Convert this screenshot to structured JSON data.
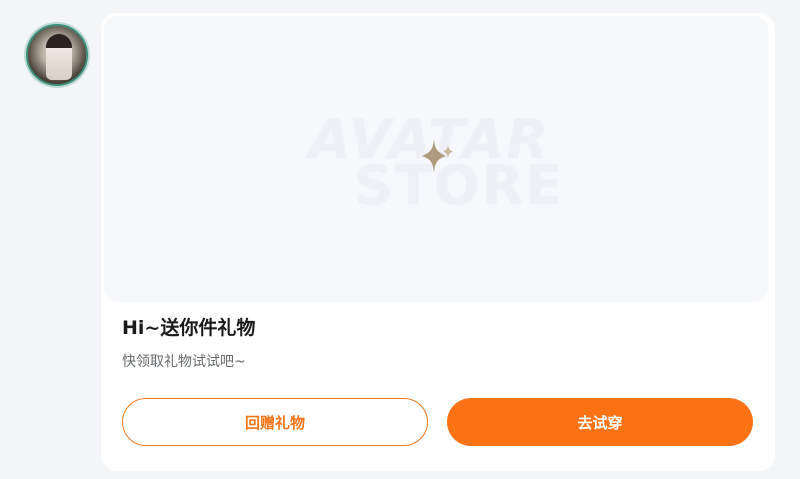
{
  "user": {
    "avatar_icon": "user-avatar"
  },
  "banner": {
    "watermark_line1": "AVATAR",
    "watermark_line2": "STORE",
    "center_icon": "sparkle-icon",
    "icon_color": "#b09a7e"
  },
  "gift": {
    "title": "Hi~送你件礼物",
    "subtitle": "快领取礼物试试吧~"
  },
  "actions": {
    "return_gift_label": "回赠礼物",
    "try_on_label": "去试穿"
  },
  "colors": {
    "accent": "#fd7313",
    "background": "#f3f5f9",
    "card": "#ffffff"
  }
}
